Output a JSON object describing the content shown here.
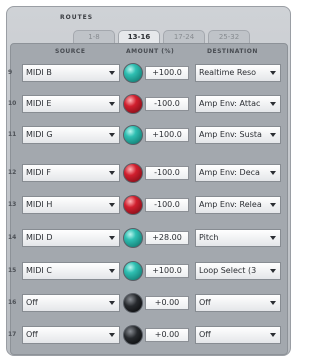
{
  "panel": {
    "title": "ROUTES",
    "tabs": [
      "1-8",
      "13-16",
      "17-24",
      "25-32"
    ],
    "active_tab": 1
  },
  "headers": {
    "source": "SOURCE",
    "amount": "AMOUNT (%)",
    "destination": "DESTINATION"
  },
  "colors": {
    "positive_knob": "#2fbfb2",
    "negative_knob": "#d11f2e",
    "zero_knob": "#1a1c1f"
  },
  "rows": [
    {
      "num": "9",
      "source": "MIDI B",
      "knob": "teal",
      "amount": "+100.0",
      "destination": "Realtime Reso"
    },
    {
      "num": "10",
      "source": "MIDI E",
      "knob": "red",
      "amount": "-100.0",
      "destination": "Amp Env: Attac"
    },
    {
      "num": "11",
      "source": "MIDI G",
      "knob": "teal",
      "amount": "+100.0",
      "destination": "Amp Env: Susta"
    },
    {
      "num": "12",
      "source": "MIDI F",
      "knob": "red",
      "amount": "-100.0",
      "destination": "Amp Env: Deca"
    },
    {
      "num": "13",
      "source": "MIDI H",
      "knob": "red",
      "amount": "-100.0",
      "destination": "Amp Env: Relea"
    },
    {
      "num": "14",
      "source": "MIDI D",
      "knob": "teal",
      "amount": "+28.00",
      "destination": "Pitch"
    },
    {
      "num": "15",
      "source": "MIDI C",
      "knob": "teal",
      "amount": "+100.0",
      "destination": "Loop Select (3"
    },
    {
      "num": "16",
      "source": "Off",
      "knob": "black",
      "amount": "+0.00",
      "destination": "Off"
    },
    {
      "num": "17",
      "source": "Off",
      "knob": "black",
      "amount": "+0.00",
      "destination": "Off"
    }
  ]
}
